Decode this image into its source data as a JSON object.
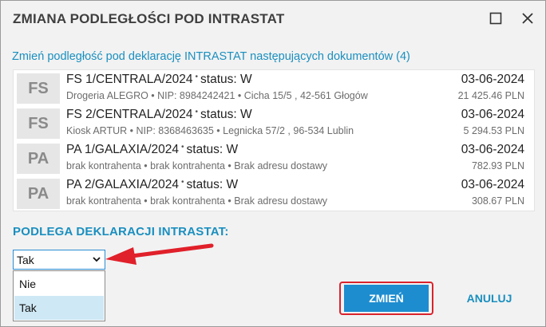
{
  "window": {
    "title": "ZMIANA PODLEGŁOŚCI POD INTRASTAT",
    "maximize_icon": "maximize-icon",
    "close_icon": "close-icon"
  },
  "intro": "Zmień podległość pod deklarację INTRASTAT następujących dokumentów (4)",
  "documents": [
    {
      "badge": "FS",
      "number": "FS 1/CENTRALA/2024",
      "status": "status: W",
      "details": "Drogeria ALEGRO • NIP: 8984242421 • Cicha  15/5 , 42-561 Głogów",
      "date": "03-06-2024",
      "amount": "21 425.46 PLN"
    },
    {
      "badge": "FS",
      "number": "FS 2/CENTRALA/2024",
      "status": "status: W",
      "details": "Kiosk ARTUR • NIP: 8368463635 • Legnicka  57/2 , 96-534 Lublin",
      "date": "03-06-2024",
      "amount": "5 294.53 PLN"
    },
    {
      "badge": "PA",
      "number": "PA 1/GALAXIA/2024",
      "status": "status: W",
      "details": "brak kontrahenta • brak kontrahenta • Brak adresu dostawy",
      "date": "03-06-2024",
      "amount": "782.93 PLN"
    },
    {
      "badge": "PA",
      "number": "PA 2/GALAXIA/2024",
      "status": "status: W",
      "details": "brak kontrahenta • brak kontrahenta • Brak adresu dostawy",
      "date": "03-06-2024",
      "amount": "308.67 PLN"
    }
  ],
  "intrastat": {
    "label": "PODLEGA DEKLARACJI INTRASTAT:",
    "selected": "Tak",
    "options": [
      "Nie",
      "Tak"
    ],
    "highlighted_option": "Tak"
  },
  "buttons": {
    "confirm": "ZMIEŃ",
    "cancel": "ANULUJ"
  },
  "colors": {
    "accent": "#1a8fbf",
    "primary_button": "#1d8dd0",
    "highlight_outline": "#d9232d",
    "annotation_arrow": "#e0202a",
    "selected_option": "#cfe8f5"
  }
}
